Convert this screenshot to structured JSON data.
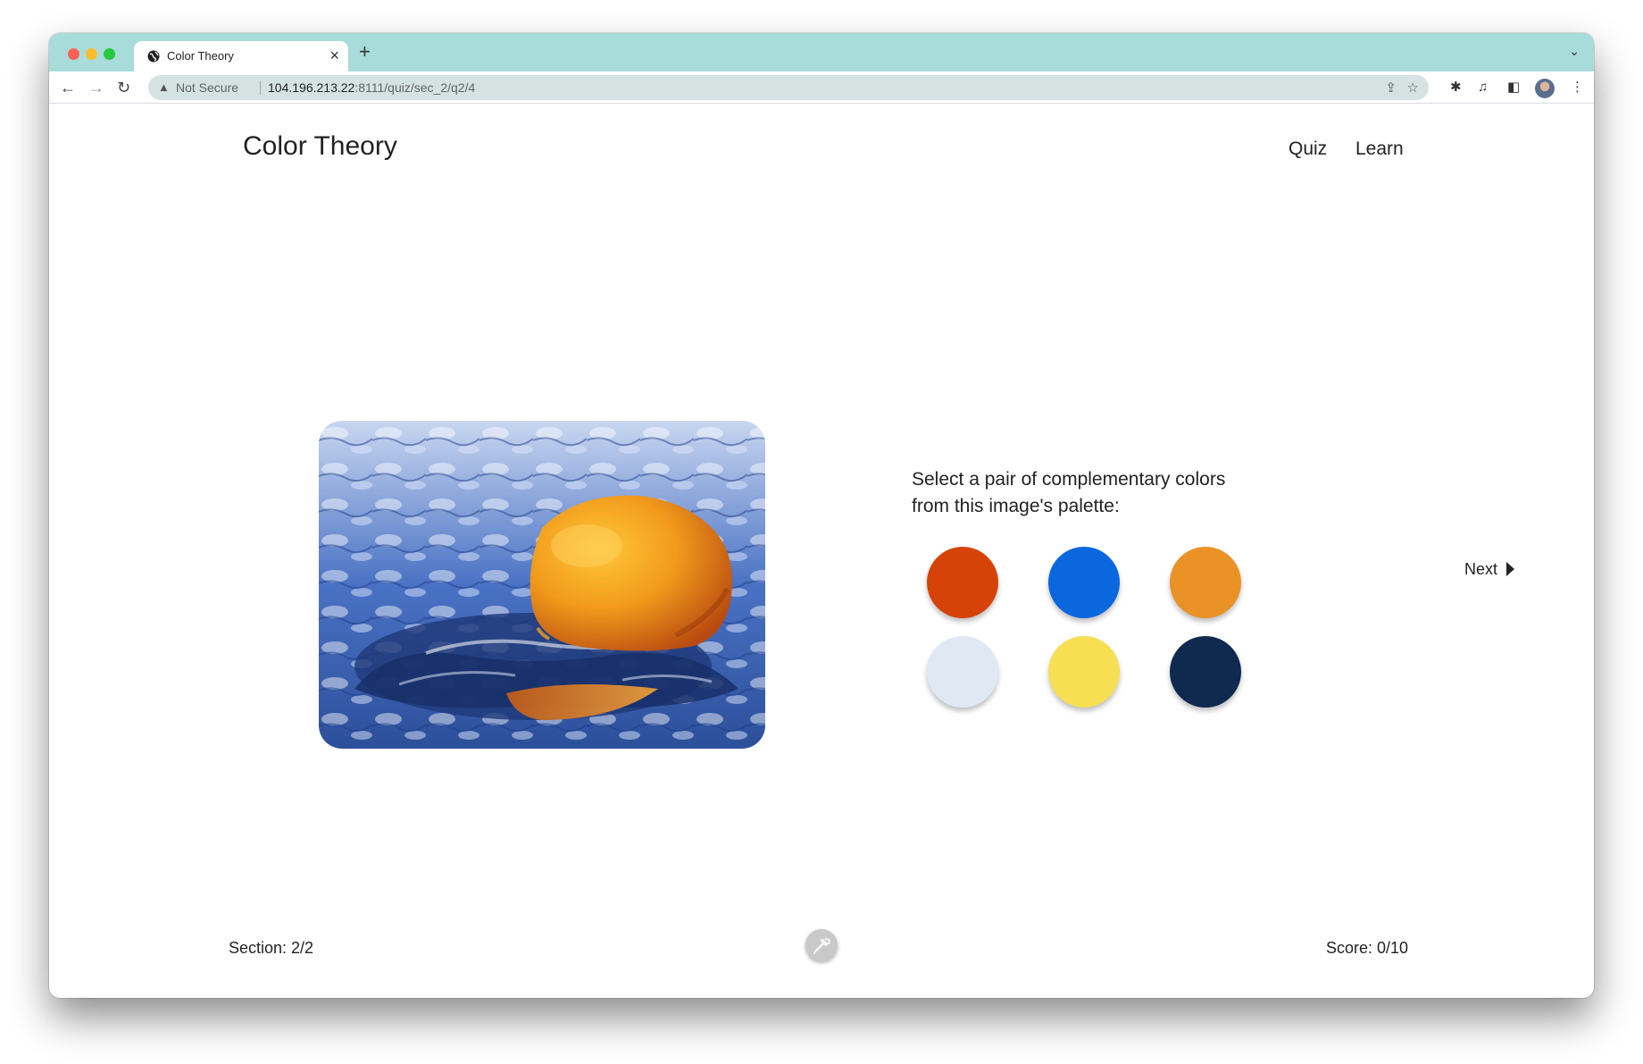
{
  "browser": {
    "tab_title": "Color Theory",
    "tab_close": "×",
    "new_tab": "+",
    "tab_menu": "⌄",
    "security_label": "Not Secure",
    "url_host": "104.196.213.22",
    "url_path": ":8111/quiz/sec_2/q2/4",
    "icons": [
      "back-arrow-icon",
      "forward-arrow-icon",
      "reload-icon",
      "warning-icon",
      "share-icon",
      "star-icon",
      "extensions-icon",
      "media-icon",
      "side-panel-icon",
      "avatar",
      "kebab-menu-icon"
    ]
  },
  "header": {
    "title": "Color Theory",
    "nav": {
      "quiz": "Quiz",
      "learn": "Learn"
    }
  },
  "quiz": {
    "question_line1": "Select a pair of complementary colors",
    "question_line2": "from this image's palette:",
    "palette": [
      "#d64309",
      "#0b67dd",
      "#ea9226",
      "#dfe8f3",
      "#f7df54",
      "#0f2a4e"
    ],
    "next_label": "Next"
  },
  "footer": {
    "section": "Section: 2/2",
    "score": "Score: 0/10"
  }
}
